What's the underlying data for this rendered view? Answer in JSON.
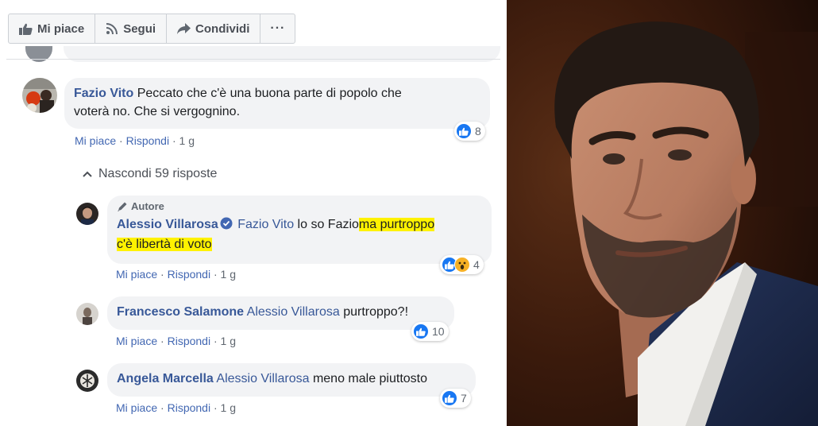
{
  "toolbar": {
    "like_label": "Mi piace",
    "follow_label": "Segui",
    "share_label": "Condividi",
    "more_label": "···"
  },
  "comments": [
    {
      "author": "Fazio Vito",
      "text": "Peccato che c'è una buona parte di popolo che voterà no. Che si vergognino.",
      "text_line1": "Peccato che c'è una buona parte di popolo che",
      "text_line2": "voterà no. Che si vergognino.",
      "like_label": "Mi piace",
      "reply_label": "Rispondi",
      "time": "1 g",
      "reactions": "8"
    }
  ],
  "replies_toggle": "Nascondi 59 risposte",
  "replies": [
    {
      "badge": "Autore",
      "author": "Alessio Villarosa",
      "verified": true,
      "mention": "Fazio Vito",
      "text_plain": "lo so Fazio",
      "text_highlight_1": "ma purtroppo",
      "text_highlight_2": "c'è libertà di voto",
      "like_label": "Mi piace",
      "reply_label": "Rispondi",
      "time": "1 g",
      "reactions": "4",
      "reaction_icons": [
        "like-icon",
        "wow-icon"
      ]
    },
    {
      "author": "Francesco Salamone",
      "mention": "Alessio Villarosa",
      "text": "purtroppo?!",
      "like_label": "Mi piace",
      "reply_label": "Rispondi",
      "time": "1 g",
      "reactions": "10"
    },
    {
      "author": "Angela Marcella",
      "mention": "Alessio Villarosa",
      "text": "meno male piuttosto",
      "like_label": "Mi piace",
      "reply_label": "Rispondi",
      "time": "1 g",
      "reactions": "7"
    }
  ],
  "separator": " · ",
  "colors": {
    "link": "#385898",
    "action_link": "#4267b2",
    "bubble": "#f2f3f5",
    "highlight": "#fff200",
    "like_blue": "#1877f2"
  }
}
